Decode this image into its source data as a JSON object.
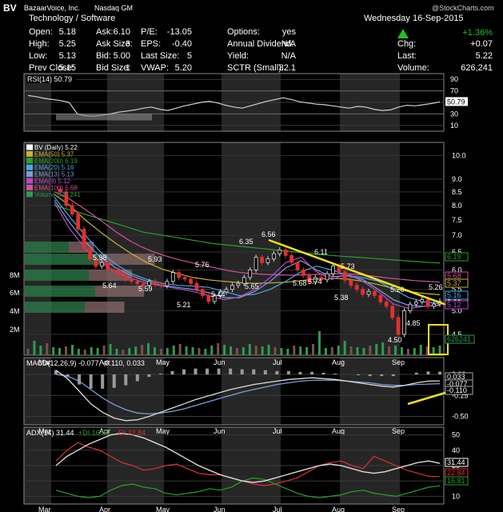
{
  "header": {
    "symbol": "BV",
    "company": "BazaarVoice, Inc.",
    "exchange": "Nasdaq GM",
    "sector": "Technology / Software",
    "date": "Wednesday 16-Sep-2015",
    "watermark": "@StockCharts.com",
    "change_pct": "+1.36%",
    "arrow_color": "#22c02a",
    "change_pct_color": "#22c02a",
    "fields": [
      {
        "k": "Open:",
        "v": "5.18"
      },
      {
        "k": "Ask:",
        "v": "6.10"
      },
      {
        "k": "P/E:",
        "v": "-13.05"
      },
      {
        "k": "Options:",
        "v": "yes"
      },
      {
        "k": "High:",
        "v": "5.25"
      },
      {
        "k": "Ask Size:",
        "v": "3"
      },
      {
        "k": "EPS:",
        "v": "-0.40"
      },
      {
        "k": "Annual Dividend:",
        "v": "N/A"
      },
      {
        "k": "Low:",
        "v": "5.13"
      },
      {
        "k": "Bid:",
        "v": "5.00"
      },
      {
        "k": "Last Size:",
        "v": "5"
      },
      {
        "k": "Yield:",
        "v": "N/A"
      },
      {
        "k": "Prev Close:",
        "v": "5.15"
      },
      {
        "k": "Bid Size:",
        "v": "1"
      },
      {
        "k": "VWAP:",
        "v": "5.20"
      },
      {
        "k": "SCTR (Small):",
        "v": "32.1"
      }
    ],
    "right": [
      {
        "k": "Chg:",
        "v": "+0.07"
      },
      {
        "k": "Last:",
        "v": "5.22"
      },
      {
        "k": "Volume:",
        "v": "626,241"
      }
    ]
  },
  "chart_data": [
    {
      "type": "line",
      "panel": "RSI",
      "title": "RSI(14) 50.79",
      "ylim": [
        0,
        100
      ],
      "yticks": [
        10,
        30,
        50,
        70,
        90
      ],
      "last_label": "50.79",
      "series": [
        {
          "name": "RSI(14)",
          "values": [
            62,
            60,
            57,
            55,
            53,
            50,
            30,
            27,
            26,
            28,
            30,
            33,
            35,
            37,
            40,
            42,
            38,
            36,
            40,
            44,
            47,
            50,
            52,
            49,
            45,
            42,
            40,
            44,
            48,
            52,
            55,
            58,
            55,
            51,
            49,
            47,
            46,
            44,
            42,
            40,
            43,
            42,
            38,
            36,
            37,
            42,
            45,
            44,
            46,
            48,
            50.79
          ]
        }
      ]
    },
    {
      "type": "line",
      "panel": "Price",
      "title": "BV (Daily) 5.22",
      "y_scale": "log",
      "ylim": [
        4.1,
        10.6
      ],
      "yticks": [
        4.5,
        5.0,
        5.5,
        6.0,
        6.5,
        7.0,
        7.5,
        8.0,
        8.5,
        9.0,
        10.0
      ],
      "vol_ticks": [
        "2M",
        "4M",
        "6M",
        "8M"
      ],
      "months": [
        "Mar",
        "Apr",
        "May",
        "Jun",
        "Jul",
        "Aug",
        "Sep"
      ],
      "legend": [
        {
          "name": "BV (Daily) 5.22",
          "color": "#ffffff"
        },
        {
          "name": "EMA(50) 5.37",
          "color": "#c8b432"
        },
        {
          "name": "EMA(200) 6.19",
          "color": "#2aa02a"
        },
        {
          "name": "EMA(20) 5.16",
          "color": "#4aa8e8"
        },
        {
          "name": "EMA(13) 5.13",
          "color": "#7aa0d8"
        },
        {
          "name": "EMA(9) 5.12",
          "color": "#b84ac8"
        },
        {
          "name": "EMA(100) 5.68",
          "color": "#d8509a"
        },
        {
          "name": "Volume 626,241",
          "color": "#2f9b50"
        }
      ],
      "price_labels": [
        "6.56",
        "6.35",
        "6.11",
        "5.98",
        "5.93",
        "5.76",
        "5.73",
        "5.74",
        "5.68",
        "5.65",
        "5.64",
        "5.59",
        "5.44",
        "5.38",
        "5.26",
        "5.21",
        "5.20",
        "4.85",
        "4.50"
      ],
      "axis_tags": [
        {
          "text": "6.19",
          "color": "#2aa02a"
        },
        {
          "text": "5.68",
          "color": "#d8509a"
        },
        {
          "text": "5.37",
          "color": "#c8b432"
        },
        {
          "text": "5.22",
          "color": "#ffffff"
        },
        {
          "text": "5.16",
          "color": "#4aa8e8"
        },
        {
          "text": "5.12",
          "color": "#b84ac8"
        },
        {
          "text": "626241",
          "color": "#2f9b50"
        }
      ],
      "series": [
        {
          "name": "BV (Daily)",
          "values": [
            8.6,
            8.5,
            8.0,
            7.7,
            7.2,
            6.6,
            6.3,
            6.1,
            6.2,
            6.0,
            5.98,
            5.85,
            5.75,
            5.7,
            5.64,
            5.6,
            5.7,
            5.62,
            5.59,
            5.7,
            5.93,
            5.8,
            5.76,
            5.65,
            5.5,
            5.35,
            5.21,
            5.35,
            5.44,
            5.5,
            5.6,
            5.65,
            5.8,
            6.0,
            6.35,
            6.2,
            6.3,
            6.45,
            6.56,
            6.4,
            6.2,
            6.0,
            5.85,
            5.68,
            5.8,
            5.74,
            5.9,
            6.11,
            5.95,
            5.73,
            5.6,
            5.5,
            5.38,
            5.45,
            5.35,
            5.2,
            5.1,
            4.85,
            4.5,
            5.0,
            5.15,
            5.2,
            5.26,
            5.1,
            5.15,
            5.22
          ]
        },
        {
          "name": "EMA(200)",
          "values": [
            8.0,
            7.9,
            7.8,
            7.7,
            7.6,
            7.5,
            7.4,
            7.3,
            7.2,
            7.1,
            7.05,
            7.0,
            6.95,
            6.9,
            6.85,
            6.8,
            6.75,
            6.72,
            6.69,
            6.66,
            6.63,
            6.6,
            6.57,
            6.54,
            6.51,
            6.48,
            6.45,
            6.42,
            6.4,
            6.38,
            6.36,
            6.34,
            6.32,
            6.3,
            6.28,
            6.26,
            6.24,
            6.22,
            6.2,
            6.19
          ]
        },
        {
          "name": "EMA(100)",
          "values": [
            8.5,
            8.3,
            8.0,
            7.7,
            7.4,
            7.1,
            6.85,
            6.65,
            6.5,
            6.38,
            6.28,
            6.2,
            6.12,
            6.05,
            5.98,
            5.93,
            5.9,
            5.88,
            5.87,
            5.86,
            5.87,
            5.88,
            5.89,
            5.9,
            5.89,
            5.86,
            5.82,
            5.78,
            5.75,
            5.72,
            5.7,
            5.68
          ]
        },
        {
          "name": "EMA(50)",
          "values": [
            8.4,
            8.0,
            7.5,
            7.1,
            6.75,
            6.45,
            6.2,
            6.02,
            5.9,
            5.8,
            5.74,
            5.7,
            5.67,
            5.65,
            5.66,
            5.68,
            5.72,
            5.76,
            5.78,
            5.76,
            5.7,
            5.62,
            5.52,
            5.45,
            5.4,
            5.37
          ]
        },
        {
          "name": "EMA(20)",
          "values": [
            8.3,
            7.6,
            7.0,
            6.5,
            6.15,
            5.9,
            5.75,
            5.65,
            5.6,
            5.58,
            5.55,
            5.45,
            5.35,
            5.38,
            5.5,
            5.7,
            5.95,
            6.1,
            6.0,
            5.85,
            5.8,
            5.7,
            5.5,
            5.3,
            5.2,
            5.16
          ]
        },
        {
          "name": "EMA(13)",
          "values": [
            8.2,
            7.4,
            6.8,
            6.35,
            6.05,
            5.85,
            5.7,
            5.6,
            5.55,
            5.5,
            5.42,
            5.3,
            5.3,
            5.45,
            5.7,
            6.05,
            6.25,
            6.0,
            5.82,
            5.85,
            5.75,
            5.5,
            5.25,
            5.12,
            5.1,
            5.13
          ]
        },
        {
          "name": "EMA(9)",
          "values": [
            8.1,
            7.2,
            6.6,
            6.2,
            5.95,
            5.78,
            5.65,
            5.58,
            5.52,
            5.45,
            5.35,
            5.25,
            5.32,
            5.5,
            5.8,
            6.2,
            6.35,
            5.95,
            5.75,
            5.9,
            5.7,
            5.45,
            5.15,
            5.05,
            5.1,
            5.12
          ]
        }
      ],
      "annotation": "Falling trendline from 6.56 to the current price; volume spike box in September"
    },
    {
      "type": "line",
      "panel": "MACD",
      "title": "MACD(12,26,9) -0.077, -0.110, 0.033",
      "ylim": [
        -0.6,
        0.2
      ],
      "yticks": [
        0.0,
        -0.25,
        -0.5
      ],
      "axis_tags": [
        "0.033",
        "-0.077",
        "-0.110"
      ],
      "series": [
        {
          "name": "MACD",
          "values": [
            0.05,
            -0.05,
            -0.2,
            -0.35,
            -0.45,
            -0.52,
            -0.55,
            -0.54,
            -0.5,
            -0.45,
            -0.4,
            -0.35,
            -0.3,
            -0.26,
            -0.22,
            -0.18,
            -0.15,
            -0.12,
            -0.1,
            -0.08,
            -0.06,
            -0.05,
            -0.04,
            -0.05,
            -0.06,
            -0.08,
            -0.1,
            -0.12,
            -0.14,
            -0.15,
            -0.13,
            -0.1,
            -0.08,
            -0.077
          ]
        },
        {
          "name": "Signal",
          "values": [
            0.0,
            -0.02,
            -0.08,
            -0.18,
            -0.28,
            -0.36,
            -0.42,
            -0.46,
            -0.47,
            -0.46,
            -0.44,
            -0.41,
            -0.37,
            -0.33,
            -0.29,
            -0.25,
            -0.21,
            -0.18,
            -0.15,
            -0.12,
            -0.1,
            -0.08,
            -0.07,
            -0.07,
            -0.07,
            -0.08,
            -0.09,
            -0.1,
            -0.12,
            -0.13,
            -0.13,
            -0.12,
            -0.115,
            -0.11
          ]
        }
      ]
    },
    {
      "type": "line",
      "panel": "ADX",
      "title": "ADX(14) 31.44",
      "legend": [
        {
          "name": "+DI 16.81",
          "color": "#2aa02a"
        },
        {
          "name": "-DI 22.84",
          "color": "#e03030"
        }
      ],
      "ylim": [
        5,
        55
      ],
      "yticks": [
        10,
        20,
        30,
        40,
        50
      ],
      "axis_tags": [
        {
          "text": "31.44",
          "color": "#ffffff"
        },
        {
          "text": "22.84",
          "color": "#e03030"
        },
        {
          "text": "16.81",
          "color": "#2aa02a"
        }
      ],
      "series": [
        {
          "name": "ADX(14)",
          "values": [
            30,
            36,
            40,
            44,
            47,
            50,
            51,
            50,
            48,
            45,
            42,
            38,
            34,
            30,
            27,
            24,
            22,
            20,
            19,
            20,
            22,
            24,
            26,
            28,
            30,
            31,
            30,
            28,
            26,
            25,
            26,
            28,
            30,
            32,
            33,
            31.44
          ]
        },
        {
          "name": "+DI",
          "values": [
            14,
            12,
            10,
            9,
            10,
            14,
            17,
            18,
            16,
            15,
            12,
            11,
            12,
            13,
            15,
            14,
            16,
            20,
            22,
            21,
            18,
            15,
            12,
            10,
            9,
            10,
            11,
            13,
            14,
            12,
            11,
            10,
            12,
            14,
            16,
            16.81
          ]
        },
        {
          "name": "-DI",
          "values": [
            33,
            40,
            45,
            42,
            40,
            36,
            32,
            30,
            27,
            28,
            30,
            31,
            28,
            25,
            24,
            24,
            22,
            20,
            18,
            17,
            18,
            20,
            22,
            26,
            30,
            32,
            33,
            30,
            28,
            36,
            33,
            30,
            27,
            25,
            23,
            22.84
          ]
        }
      ]
    }
  ]
}
